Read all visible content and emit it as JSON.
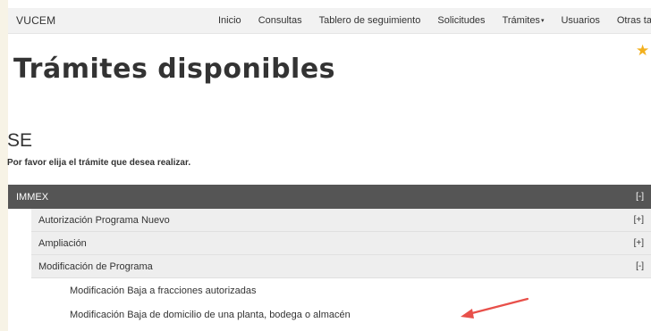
{
  "brand": "VUCEM",
  "nav": {
    "items": [
      "Inicio",
      "Consultas",
      "Tablero de seguimiento",
      "Solicitudes",
      "Trámites",
      "Usuarios",
      "Otras tareas"
    ],
    "dropdown_caret": "▾"
  },
  "favorite_icon": "star-icon",
  "page_title": "Trámites disponibles",
  "section_title": "SE",
  "instructions": "Por favor elija el trámite que desea realizar.",
  "tree": {
    "root": {
      "label": "IMMEX",
      "toggle": "[-]"
    },
    "children": [
      {
        "label": "Autorización Programa Nuevo",
        "toggle": "[+]"
      },
      {
        "label": "Ampliación",
        "toggle": "[+]"
      },
      {
        "label": "Modificación de Programa",
        "toggle": "[-]"
      }
    ],
    "leaves": [
      {
        "label": "Modificación Baja a fracciones autorizadas"
      },
      {
        "label": "Modificación Baja de domicilio de una planta, bodega o almacén"
      }
    ]
  },
  "colors": {
    "header_row": "#555555",
    "sub_row": "#eeeeee",
    "arrow": "#e8504a",
    "star": "#f2b01e"
  }
}
